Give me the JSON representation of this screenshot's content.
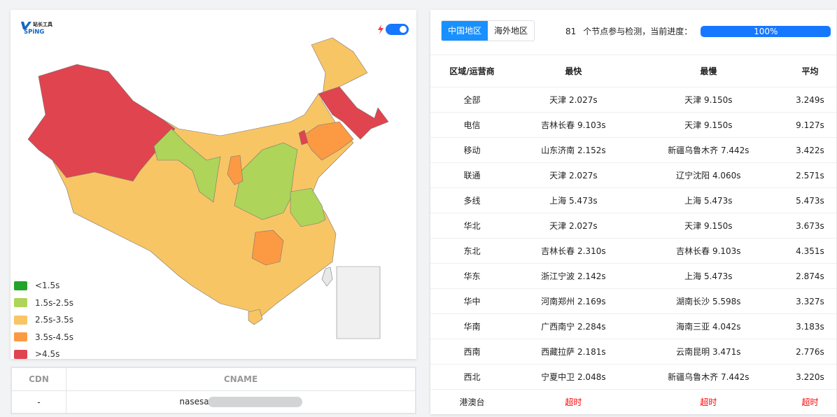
{
  "logo": {
    "text": "站长工具",
    "brand": "VSPiNG"
  },
  "toggle": {
    "on": true,
    "icon": "lightning-icon"
  },
  "legend": [
    {
      "label": "<1.5s",
      "color": "#22a32a"
    },
    {
      "label": "1.5s-2.5s",
      "color": "#aed45a"
    },
    {
      "label": "2.5s-3.5s",
      "color": "#f8c565"
    },
    {
      "label": "3.5s-4.5s",
      "color": "#fb9a42"
    },
    {
      "label": ">4.5s",
      "color": "#e0444f"
    }
  ],
  "cdn_table": {
    "headers": [
      "CDN",
      "CNAME"
    ],
    "rows": [
      [
        "-",
        "nasesa"
      ]
    ]
  },
  "tabs": [
    {
      "label": "中国地区",
      "active": true
    },
    {
      "label": "海外地区",
      "active": false
    }
  ],
  "progress": {
    "count": "81",
    "text": "个节点参与检测，当前进度：",
    "percent": 100,
    "label": "100%"
  },
  "table": {
    "headers": [
      "区域/运营商",
      "最快",
      "最慢",
      "平均"
    ],
    "rows": [
      [
        "全部",
        "天津 2.027s",
        "天津 9.150s",
        "3.249s"
      ],
      [
        "电信",
        "吉林长春 9.103s",
        "天津 9.150s",
        "9.127s"
      ],
      [
        "移动",
        "山东济南 2.152s",
        "新疆乌鲁木齐 7.442s",
        "3.422s"
      ],
      [
        "联通",
        "天津 2.027s",
        "辽宁沈阳 4.060s",
        "2.571s"
      ],
      [
        "多线",
        "上海 5.473s",
        "上海 5.473s",
        "5.473s"
      ],
      [
        "华北",
        "天津 2.027s",
        "天津 9.150s",
        "3.673s"
      ],
      [
        "东北",
        "吉林长春 2.310s",
        "吉林长春 9.103s",
        "4.351s"
      ],
      [
        "华东",
        "浙江宁波 2.142s",
        "上海 5.473s",
        "2.874s"
      ],
      [
        "华中",
        "河南郑州 2.169s",
        "湖南长沙 5.598s",
        "3.327s"
      ],
      [
        "华南",
        "广西南宁 2.284s",
        "海南三亚 4.042s",
        "3.183s"
      ],
      [
        "西南",
        "西藏拉萨 2.181s",
        "云南昆明 3.471s",
        "2.776s"
      ],
      [
        "西北",
        "宁夏中卫 2.048s",
        "新疆乌鲁木齐 7.442s",
        "3.220s"
      ],
      [
        "港澳台",
        "超时",
        "超时",
        "超时"
      ]
    ]
  }
}
